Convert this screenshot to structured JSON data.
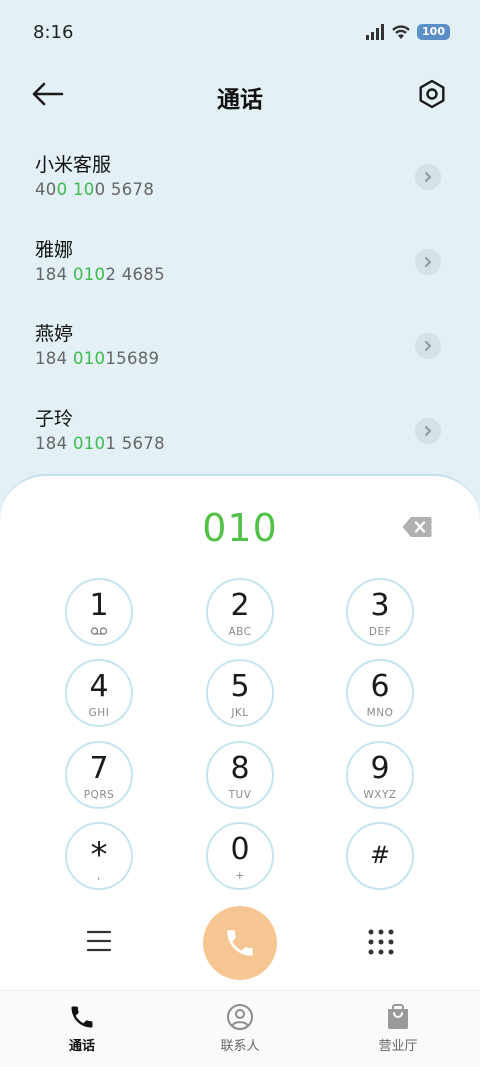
{
  "status_bar": {
    "time": "8:16",
    "battery": "100"
  },
  "header": {
    "title": "通话"
  },
  "contacts": [
    {
      "name": "小米客服",
      "number_parts": [
        {
          "t": "40",
          "h": false
        },
        {
          "t": "0",
          "h": true
        },
        {
          "t": " ",
          "h": false
        },
        {
          "t": "10",
          "h": true
        },
        {
          "t": "0 5678",
          "h": false
        }
      ]
    },
    {
      "name": "雅娜",
      "number_parts": [
        {
          "t": "184 ",
          "h": false
        },
        {
          "t": "010",
          "h": true
        },
        {
          "t": "2 4685",
          "h": false
        }
      ]
    },
    {
      "name": "燕婷",
      "number_parts": [
        {
          "t": "184 ",
          "h": false
        },
        {
          "t": "010",
          "h": true
        },
        {
          "t": "15689",
          "h": false
        }
      ]
    },
    {
      "name": "子玲",
      "number_parts": [
        {
          "t": "184 ",
          "h": false
        },
        {
          "t": "010",
          "h": true
        },
        {
          "t": "1 5678",
          "h": false
        }
      ]
    }
  ],
  "dialer": {
    "display": "010",
    "keys": [
      {
        "digit": "1",
        "letters": "voicemail-icon"
      },
      {
        "digit": "2",
        "letters": "ABC"
      },
      {
        "digit": "3",
        "letters": "DEF"
      },
      {
        "digit": "4",
        "letters": "GHI"
      },
      {
        "digit": "5",
        "letters": "JKL"
      },
      {
        "digit": "6",
        "letters": "MNO"
      },
      {
        "digit": "7",
        "letters": "PQRS"
      },
      {
        "digit": "8",
        "letters": "TUV"
      },
      {
        "digit": "9",
        "letters": "WXYZ"
      },
      {
        "digit": "*",
        "letters": ","
      },
      {
        "digit": "0",
        "letters": "+"
      },
      {
        "digit": "#",
        "letters": ""
      }
    ]
  },
  "nav": [
    {
      "label": "通话",
      "icon": "phone-icon",
      "active": true
    },
    {
      "label": "联系人",
      "icon": "person-icon",
      "active": false
    },
    {
      "label": "营业厅",
      "icon": "bag-icon",
      "active": false
    }
  ],
  "colors": {
    "accent": "#52c148",
    "call_button": "#f6c692",
    "key_border": "#c5e4f1",
    "background": "#e3f0f5"
  }
}
